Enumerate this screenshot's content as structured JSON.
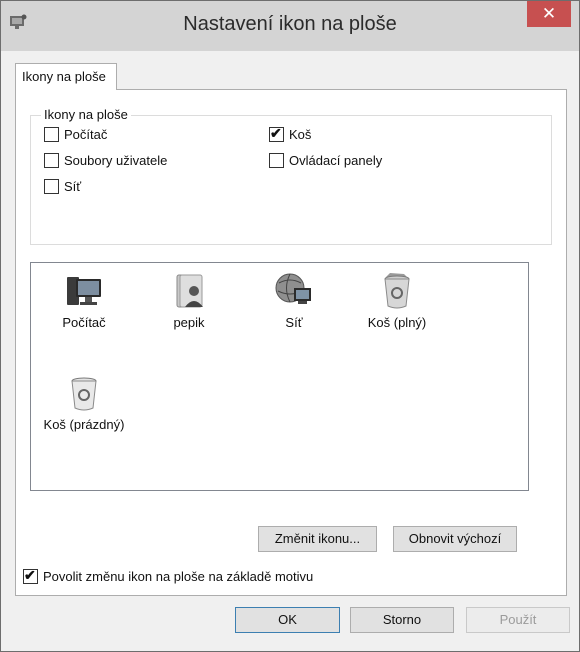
{
  "window": {
    "title": "Nastavení ikon na ploše",
    "close_glyph": "✕",
    "app_icon": "desktop-settings-icon"
  },
  "tab": {
    "label": "Ikony na ploše"
  },
  "group": {
    "legend": "Ikony na ploše",
    "checkboxes": [
      {
        "label": "Počítač",
        "checked": false
      },
      {
        "label": "Koš",
        "checked": true
      },
      {
        "label": "Soubory uživatele",
        "checked": false
      },
      {
        "label": "Ovládací panely",
        "checked": false
      },
      {
        "label": "Síť",
        "checked": false
      }
    ]
  },
  "icons": [
    {
      "label": "Počítač",
      "icon": "computer-icon"
    },
    {
      "label": "pepik",
      "icon": "user-folder-icon"
    },
    {
      "label": "Síť",
      "icon": "network-icon"
    },
    {
      "label": "Koš (plný)",
      "icon": "recycle-bin-full-icon"
    },
    {
      "label": "Koš (prázdný)",
      "icon": "recycle-bin-empty-icon"
    }
  ],
  "buttons": {
    "change_icon": "Změnit ikonu...",
    "restore_default": "Obnovit výchozí"
  },
  "allow_themes": {
    "label": "Povolit změnu ikon na ploše na základě motivu",
    "checked": true
  },
  "footer": {
    "ok": "OK",
    "cancel": "Storno",
    "apply": "Použít"
  }
}
